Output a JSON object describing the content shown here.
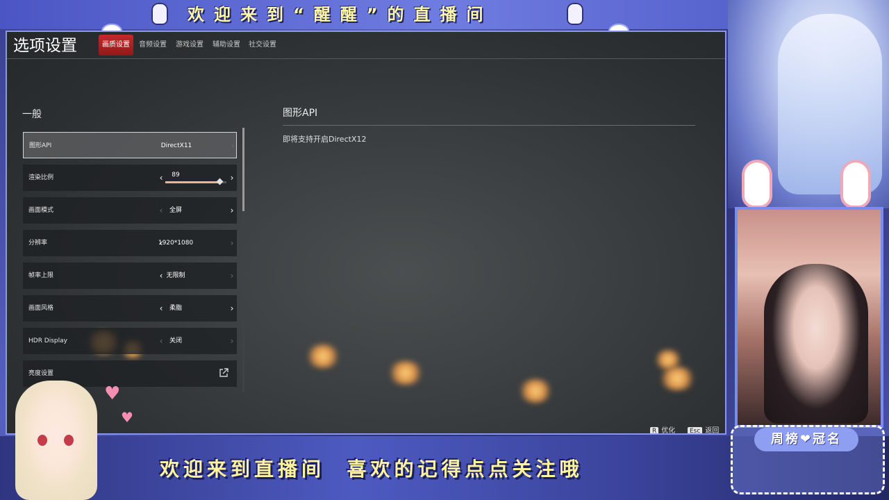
{
  "overlay": {
    "banner_title": "欢迎来到“醒醒”的直播间",
    "bottom_text": "欢迎来到直播间  喜欢的记得点点关注哦",
    "rank_title": "周榜❤冠名"
  },
  "game": {
    "page_title": "选项设置",
    "tabs": [
      {
        "label": "画质设置",
        "active": true
      },
      {
        "label": "音频设置",
        "active": false
      },
      {
        "label": "游戏设置",
        "active": false
      },
      {
        "label": "辅助设置",
        "active": false
      },
      {
        "label": "社交设置",
        "active": false
      }
    ],
    "section_title": "一般",
    "settings": [
      {
        "label": "图形API",
        "value": "DirectX11"
      },
      {
        "label": "渲染比例",
        "value": "89",
        "slider_fraction": 0.89
      },
      {
        "label": "画面模式",
        "value": "全屏"
      },
      {
        "label": "分辨率",
        "value": "1920*1080"
      },
      {
        "label": "帧率上限",
        "value": "无限制"
      },
      {
        "label": "画面风格",
        "value": "柔脂"
      },
      {
        "label": "HDR Display",
        "value": "关闭"
      },
      {
        "label": "亮度设置",
        "value": ""
      }
    ],
    "detail": {
      "title": "图形API",
      "description": "即将支持开启DirectX12"
    },
    "hints": [
      {
        "key": "R",
        "label": "优化"
      },
      {
        "key": "Esc",
        "label": "返回"
      }
    ]
  },
  "icons": {
    "external_link": "external-link-icon",
    "arrow_left": "chevron-left-icon",
    "arrow_right": "chevron-right-icon"
  },
  "colors": {
    "active_tab": "#c62828",
    "slider_fill": "#e8b98c",
    "frame_accent": "#8a96f0"
  }
}
